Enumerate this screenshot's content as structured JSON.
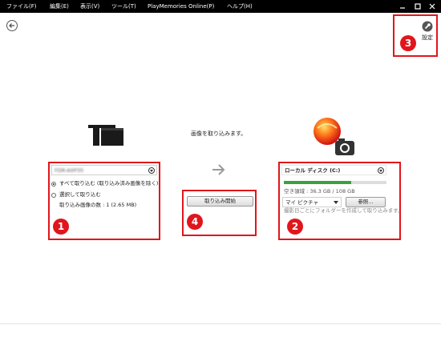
{
  "menubar": {
    "items": [
      "ファイル(F)",
      "編集(E)",
      "表示(V)",
      "ツール(T)",
      "PlayMemories Online(P)",
      "ヘルプ(H)"
    ],
    "window_controls": [
      "minimize-icon",
      "maximize-icon",
      "close-icon"
    ]
  },
  "toolbar": {
    "back_icon": "back-arrow-icon",
    "settings_icon": "wrench-icon",
    "settings_label": "設定"
  },
  "main": {
    "title": "画像を取り込みます。",
    "arrow_icon": "right-arrow-icon",
    "source": {
      "device_name": "FDR-AXP35",
      "options": [
        {
          "label": "すべて取り込む (取り込み済み画像を除く)",
          "selected": true
        },
        {
          "label": "選択して取り込む",
          "selected": false
        }
      ],
      "count_text": "取り込み画像の数 : 1 (2.65 MB)"
    },
    "import_button": "取り込み開始",
    "destination": {
      "drive": "ローカル ディスク (C:)",
      "free_space_text": "空き領域 : 36.3 GB / 108 GB",
      "used_fraction": 0.66,
      "folder": "マイ ピクチャ",
      "browse_button": "参照...",
      "folder_note": "撮影日ごとにフォルダーを作成して取り込みます。"
    }
  },
  "badges": [
    "1",
    "2",
    "3",
    "4"
  ],
  "colors": {
    "menubar_bg": "#000000",
    "highlight_red": "#e0161c",
    "progress_green": "#3aa23a"
  }
}
